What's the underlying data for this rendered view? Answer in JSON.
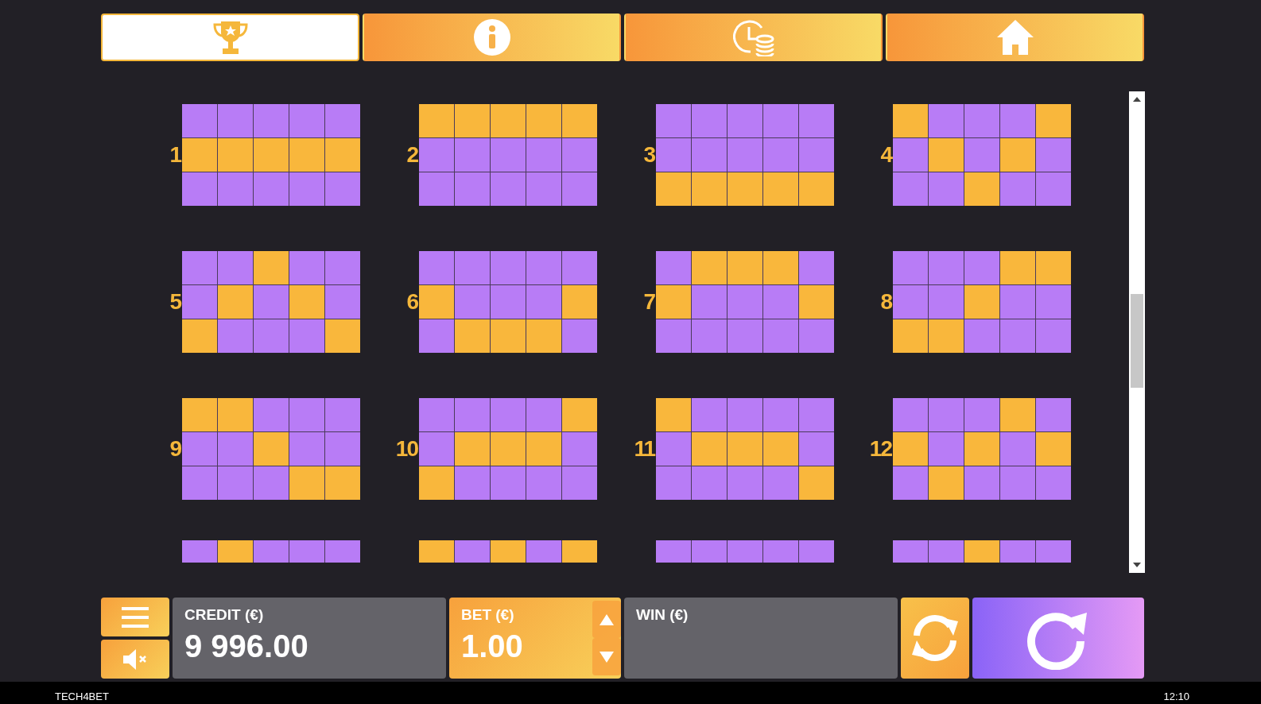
{
  "tabs": [
    {
      "kind": "trophy",
      "selected": true
    },
    {
      "kind": "info",
      "selected": false
    },
    {
      "kind": "history",
      "selected": false
    },
    {
      "kind": "home",
      "selected": false
    }
  ],
  "paylines": [
    {
      "number": "1",
      "rows": [
        [
          false,
          false,
          false,
          false,
          false
        ],
        [
          true,
          true,
          true,
          true,
          true
        ],
        [
          false,
          false,
          false,
          false,
          false
        ]
      ]
    },
    {
      "number": "2",
      "rows": [
        [
          true,
          true,
          true,
          true,
          true
        ],
        [
          false,
          false,
          false,
          false,
          false
        ],
        [
          false,
          false,
          false,
          false,
          false
        ]
      ]
    },
    {
      "number": "3",
      "rows": [
        [
          false,
          false,
          false,
          false,
          false
        ],
        [
          false,
          false,
          false,
          false,
          false
        ],
        [
          true,
          true,
          true,
          true,
          true
        ]
      ]
    },
    {
      "number": "4",
      "rows": [
        [
          true,
          false,
          false,
          false,
          true
        ],
        [
          false,
          true,
          false,
          true,
          false
        ],
        [
          false,
          false,
          true,
          false,
          false
        ]
      ]
    },
    {
      "number": "5",
      "rows": [
        [
          false,
          false,
          true,
          false,
          false
        ],
        [
          false,
          true,
          false,
          true,
          false
        ],
        [
          true,
          false,
          false,
          false,
          true
        ]
      ]
    },
    {
      "number": "6",
      "rows": [
        [
          false,
          false,
          false,
          false,
          false
        ],
        [
          true,
          false,
          false,
          false,
          true
        ],
        [
          false,
          true,
          true,
          true,
          false
        ]
      ]
    },
    {
      "number": "7",
      "rows": [
        [
          false,
          true,
          true,
          true,
          false
        ],
        [
          true,
          false,
          false,
          false,
          true
        ],
        [
          false,
          false,
          false,
          false,
          false
        ]
      ]
    },
    {
      "number": "8",
      "rows": [
        [
          false,
          false,
          false,
          true,
          true
        ],
        [
          false,
          false,
          true,
          false,
          false
        ],
        [
          true,
          true,
          false,
          false,
          false
        ]
      ]
    },
    {
      "number": "9",
      "rows": [
        [
          true,
          true,
          false,
          false,
          false
        ],
        [
          false,
          false,
          true,
          false,
          false
        ],
        [
          false,
          false,
          false,
          true,
          true
        ]
      ]
    },
    {
      "number": "10",
      "rows": [
        [
          false,
          false,
          false,
          false,
          true
        ],
        [
          false,
          true,
          true,
          true,
          false
        ],
        [
          true,
          false,
          false,
          false,
          false
        ]
      ]
    },
    {
      "number": "11",
      "rows": [
        [
          true,
          false,
          false,
          false,
          false
        ],
        [
          false,
          true,
          true,
          true,
          false
        ],
        [
          false,
          false,
          false,
          false,
          true
        ]
      ]
    },
    {
      "number": "12",
      "rows": [
        [
          false,
          false,
          false,
          true,
          false
        ],
        [
          true,
          false,
          true,
          false,
          true
        ],
        [
          false,
          true,
          false,
          false,
          false
        ]
      ]
    },
    {
      "rows": [
        [
          false,
          true,
          false,
          false,
          false
        ]
      ]
    },
    {
      "rows": [
        [
          true,
          false,
          true,
          false,
          true
        ]
      ]
    },
    {
      "rows": [
        [
          false,
          false,
          false,
          false,
          false
        ]
      ]
    },
    {
      "rows": [
        [
          false,
          false,
          true,
          false,
          false
        ]
      ]
    }
  ],
  "credit": {
    "label": "CREDIT (€)",
    "value": "9 996.00"
  },
  "bet": {
    "label": "BET (€)",
    "value": "1.00"
  },
  "win": {
    "label": "WIN (€)"
  },
  "status_bar": {
    "provider": "TECH4BET",
    "time": "12:10"
  }
}
